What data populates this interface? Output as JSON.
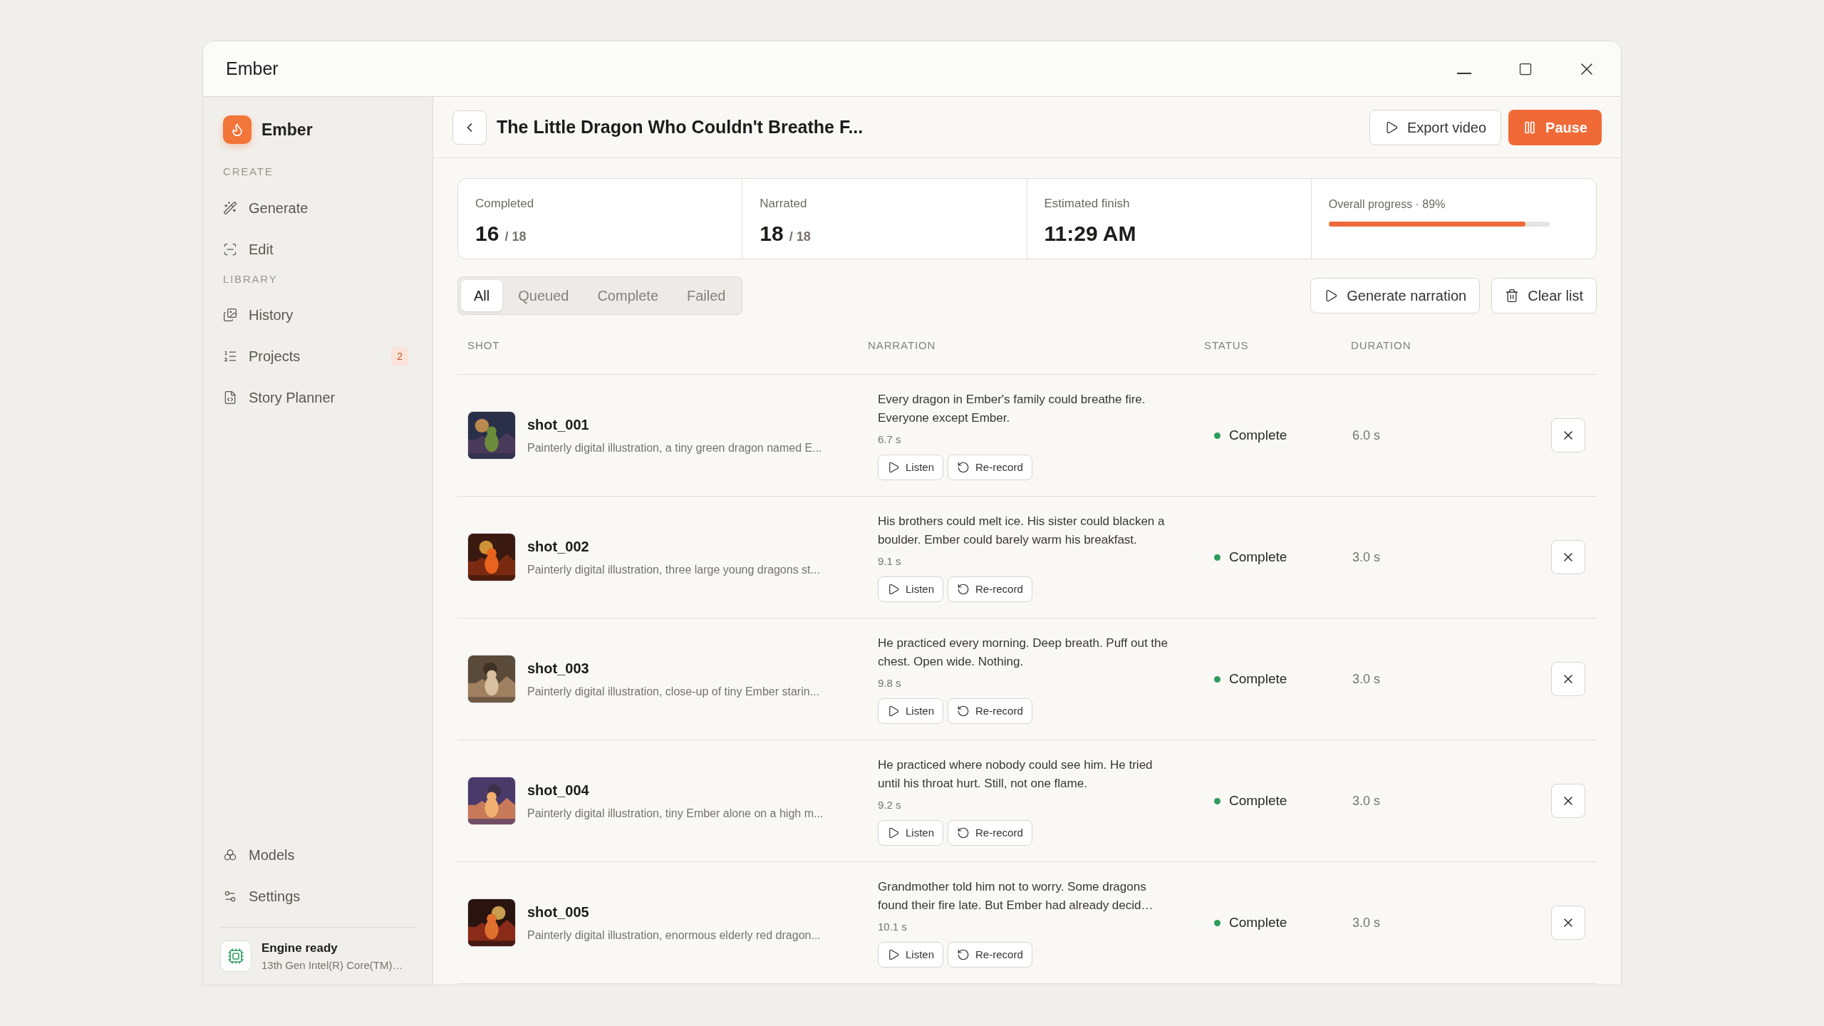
{
  "window": {
    "title": "Ember"
  },
  "sidebar": {
    "brand": "Ember",
    "sections": [
      {
        "heading": "CREATE",
        "items": [
          {
            "label": "Generate"
          },
          {
            "label": "Edit"
          }
        ]
      },
      {
        "heading": "LIBRARY",
        "items": [
          {
            "label": "History"
          },
          {
            "label": "Projects",
            "badge": "2"
          },
          {
            "label": "Story Planner"
          }
        ]
      }
    ],
    "bottom_items": [
      {
        "label": "Models"
      },
      {
        "label": "Settings"
      }
    ],
    "engine": {
      "title": "Engine ready",
      "detail": "13th Gen Intel(R) Core(TM)…"
    }
  },
  "header": {
    "title": "The Little Dragon Who Couldn't Breathe F...",
    "buttons": [
      {
        "label": "Export video",
        "kind": "outline"
      },
      {
        "label": "Pause",
        "kind": "primary"
      }
    ]
  },
  "stats": [
    {
      "label": "Completed",
      "value": "16",
      "total": "/ 18"
    },
    {
      "label": "Narrated",
      "value": "18",
      "total": "/ 18"
    },
    {
      "label": "Estimated finish",
      "value": "11:29 AM"
    }
  ],
  "progress": {
    "label": "Overall progress · 89%",
    "level": 0.89
  },
  "tabs": [
    {
      "label": "All",
      "selected": true
    },
    {
      "label": "Queued",
      "selected": false
    },
    {
      "label": "Complete",
      "selected": false
    },
    {
      "label": "Failed",
      "selected": false
    }
  ],
  "actions": [
    {
      "label": "Generate narration",
      "kind": "play"
    },
    {
      "label": "Clear list",
      "kind": "trash"
    }
  ],
  "table": {
    "columns": [
      "SHOT",
      "NARRATION",
      "STATUS",
      "DURATION"
    ],
    "rows": [
      {
        "shot": "shot_001",
        "prompt": "Painterly digital illustration, a tiny green dragon named E...",
        "narration": "Every dragon in Ember's family could breathe fire. Everyone except Ember.",
        "narration_length": "6.7 s",
        "buttons": [
          "Listen",
          "Re-record"
        ],
        "status": "Complete",
        "duration": "6.0 s"
      },
      {
        "shot": "shot_002",
        "prompt": "Painterly digital illustration, three large young dragons st...",
        "narration": "His brothers could melt ice. His sister could blacken a boulder. Ember could barely warm his breakfast.",
        "narration_length": "9.1 s",
        "buttons": [
          "Listen",
          "Re-record"
        ],
        "status": "Complete",
        "duration": "3.0 s"
      },
      {
        "shot": "shot_003",
        "prompt": "Painterly digital illustration, close-up of tiny Ember starin...",
        "narration": "He practiced every morning. Deep breath. Puff out the chest. Open wide. Nothing.",
        "narration_length": "9.8 s",
        "buttons": [
          "Listen",
          "Re-record"
        ],
        "status": "Complete",
        "duration": "3.0 s"
      },
      {
        "shot": "shot_004",
        "prompt": "Painterly digital illustration, tiny Ember alone on a high m...",
        "narration": "He practiced where nobody could see him. He tried until his throat hurt. Still, not one flame.",
        "narration_length": "9.2 s",
        "buttons": [
          "Listen",
          "Re-record"
        ],
        "status": "Complete",
        "duration": "3.0 s"
      },
      {
        "shot": "shot_005",
        "prompt": "Painterly digital illustration, enormous elderly red dragon...",
        "narration": "Grandmother told him not to worry. Some dragons found their fire late. But Ember had already decid…",
        "narration_length": "10.1 s",
        "buttons": [
          "Listen",
          "Re-record"
        ],
        "status": "Complete",
        "duration": "3.0 s"
      }
    ]
  }
}
